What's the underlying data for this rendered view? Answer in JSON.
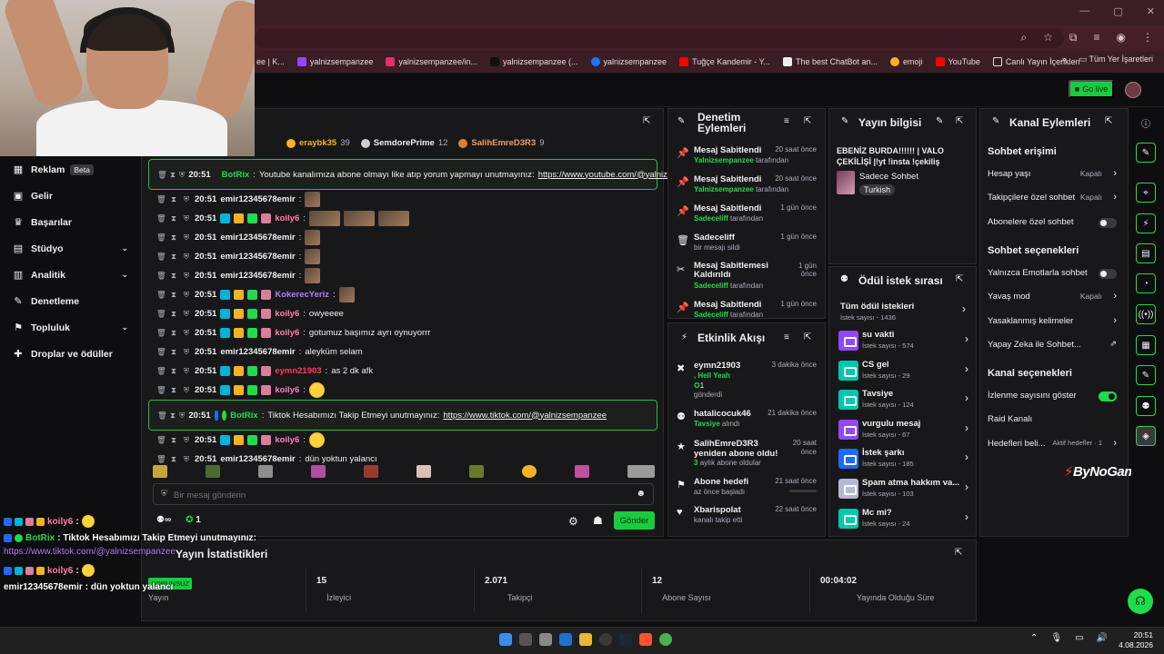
{
  "browser": {
    "bookmarks": [
      {
        "label": "ee | K...",
        "color": "#ad5cff"
      },
      {
        "label": "yalnizsempanzee",
        "color": "#9146ff"
      },
      {
        "label": "yalnizsempanzee/in...",
        "color": "#e1306c"
      },
      {
        "label": "yalnizsempanzee (...",
        "color": "#222222"
      },
      {
        "label": "yalnizsempanzee",
        "color": "#1877f2"
      },
      {
        "label": "Tuğçe Kandemir - Y...",
        "color": "#ff0000"
      },
      {
        "label": "The best ChatBot an...",
        "color": "#eeeeee"
      },
      {
        "label": "emoji",
        "color": "#f5b324"
      },
      {
        "label": "YouTube",
        "color": "#ff0000"
      },
      {
        "label": "Canlı Yayın İçerikleri",
        "color": "#e6dadd"
      }
    ],
    "all_bookmarks": "Tüm Yer İşaretleri"
  },
  "topbar": {
    "go_live": "Go live"
  },
  "sidebar": {
    "items": [
      {
        "label": "Reklam",
        "badge": "Beta",
        "icon": "ad-icon"
      },
      {
        "label": "Gelir",
        "icon": "revenue-icon"
      },
      {
        "label": "Başarılar",
        "icon": "trophy-icon"
      },
      {
        "label": "Stüdyo",
        "icon": "studio-icon",
        "expandable": true
      },
      {
        "label": "Analitik",
        "icon": "analytics-icon",
        "expandable": true
      },
      {
        "label": "Denetleme",
        "icon": "wrench-icon"
      },
      {
        "label": "Topluluk",
        "icon": "community-icon",
        "expandable": true
      },
      {
        "label": "Droplar ve ödüller",
        "icon": "gift-icon"
      }
    ]
  },
  "chat": {
    "leaderboard": [
      {
        "name": "eraybk35",
        "count": "39",
        "color": "#f5b324"
      },
      {
        "name": "SemdorePrime",
        "count": "12",
        "color": "#cfcfcf"
      },
      {
        "name": "SalihEmreD3R3",
        "count": "9",
        "color": "#d98236"
      }
    ],
    "messages": [
      {
        "time": "20:51",
        "user": "BotRix",
        "user_color": "#1fdc4b",
        "text": "Youtube kanalımıza abone olmayı like atıp yorum yapmayı unutmayınız:",
        "link": "https://www.youtube.com/@yalnizsempanzee",
        "highlight": true
      },
      {
        "time": "20:51",
        "user": "emir12345678emir",
        "user_color": "#efeff1",
        "text": "",
        "emotes": 1
      },
      {
        "time": "20:51",
        "user": "koily6",
        "user_color": "#ff7eb6",
        "text": "",
        "emotes": 3,
        "wide": true
      },
      {
        "time": "20:51",
        "user": "emir12345678emir",
        "user_color": "#efeff1",
        "text": "",
        "emotes": 1
      },
      {
        "time": "20:51",
        "user": "emir12345678emir",
        "user_color": "#efeff1",
        "text": "",
        "emotes": 1
      },
      {
        "time": "20:51",
        "user": "emir12345678emir",
        "user_color": "#efeff1",
        "text": "",
        "emotes": 1
      },
      {
        "time": "20:51",
        "user": "KokerecYeriz",
        "user_color": "#b57bff",
        "text": "",
        "emotes": 1
      },
      {
        "time": "20:51",
        "user": "koily6",
        "user_color": "#ff7eb6",
        "text": "owyeeee"
      },
      {
        "time": "20:51",
        "user": "koily6",
        "user_color": "#ff7eb6",
        "text": "gotumuz başımız ayrı oynuyorrr"
      },
      {
        "time": "20:51",
        "user": "emir12345678emir",
        "user_color": "#efeff1",
        "text": "aleyküm selam"
      },
      {
        "time": "20:51",
        "user": "eymn21903",
        "user_color": "#ff3d5a",
        "text": "as 2 dk afk"
      },
      {
        "time": "20:51",
        "user": "koily6",
        "user_color": "#ff7eb6",
        "text": "",
        "emotes": 1,
        "yellow": true
      },
      {
        "time": "20:51",
        "user": "BotRix",
        "user_color": "#1fdc4b",
        "text": "Tiktok Hesabımızı Takip Etmeyi unutmayınız:",
        "link": "https://www.tiktok.com/@yalnizsempanzee",
        "highlight": true
      },
      {
        "time": "20:51",
        "user": "koily6",
        "user_color": "#ff7eb6",
        "text": "",
        "emotes": 1,
        "yellow": true
      },
      {
        "time": "20:51",
        "user": "emir12345678emir",
        "user_color": "#efeff1",
        "text": "dün yoktun yalancı"
      }
    ],
    "input_placeholder": "Bir mesaj gönderin",
    "footer_count": "1",
    "send_label": "Gönder"
  },
  "mod_actions": {
    "title": "Denetim Eylemleri",
    "rows": [
      {
        "title": "Mesaj Sabitlendi",
        "user": "Yalnizsempanzee",
        "suffix": "tarafından",
        "time": "20 saat önce",
        "icon": "pin-icon"
      },
      {
        "title": "Mesaj Sabitlendi",
        "user": "Yalnizsempanzee",
        "suffix": "tarafından",
        "time": "20 saat önce",
        "icon": "pin-icon"
      },
      {
        "title": "Mesaj Sabitlendi",
        "user": "Sadeceliff",
        "suffix": "tarafından",
        "time": "1 gün önce",
        "icon": "pin-icon"
      },
      {
        "title": "Sadeceliff",
        "user": "",
        "suffix": "bir mesajı sildi",
        "time": "1 gün önce",
        "icon": "trash-icon"
      },
      {
        "title": "Mesaj Sabitlemesi Kaldırıldı",
        "user": "Sadeceliff",
        "suffix": "tarafından",
        "time": "1 gün önce",
        "icon": "unpin-icon"
      },
      {
        "title": "Mesaj Sabitlendi",
        "user": "Sadeceliff",
        "suffix": "tarafından",
        "time": "1 gün önce",
        "icon": "pin-icon"
      }
    ]
  },
  "activity": {
    "title": "Etkinlik Akışı",
    "rows": [
      {
        "title": "eymn21903",
        "sub_green": ", Hell Yeah",
        "sub2": "1",
        "sub3": "gönderdi",
        "time": "3 dakika önce",
        "icon": "bits-icon"
      },
      {
        "title": "hatalicocuk46",
        "sub_green": "Tavsiye",
        "sub": "alındı",
        "time": "21 dakika önce",
        "icon": "reward-icon"
      },
      {
        "title": "SalihEmreD3R3 yeniden abone oldu!",
        "sub_green": "3",
        "sub": "aylık abone oldular",
        "time": "20 saat önce",
        "icon": "star-icon"
      },
      {
        "title": "Abone hedefi",
        "sub": "az önce başladı",
        "time": "21 saat önce",
        "icon": "goal-icon"
      },
      {
        "title": "Xbarispolat",
        "sub": "kanalı takip etti",
        "time": "22 saat önce",
        "icon": "heart-icon"
      }
    ]
  },
  "stream_info": {
    "title": "Yayın bilgisi",
    "stream_title": "EBENİZ BURDA!!!!!! | VALO ÇEKİLİŞİ |!yt !insta !çekiliş",
    "category": "Sadece Sohbet",
    "tag": "Turkish"
  },
  "rewards": {
    "title": "Ödül istek sırası",
    "all_label": "Tüm ödül istekleri",
    "all_count": "İstek sayısı - 1436",
    "items": [
      {
        "name": "su vakti",
        "count": "İstek sayısı - 574",
        "color": "#9147ff"
      },
      {
        "name": "CS gel",
        "count": "İstek sayısı - 29",
        "color": "#00c8af"
      },
      {
        "name": "Tavsiye",
        "count": "İstek sayısı - 124",
        "color": "#00c8af"
      },
      {
        "name": "vurgulu mesaj",
        "count": "İstek sayısı - 67",
        "color": "#9147ff"
      },
      {
        "name": "İstek şarkı",
        "count": "İstek sayısı - 185",
        "color": "#1e69ff"
      },
      {
        "name": "Spam atma hakkım va...",
        "count": "İstek sayısı - 103",
        "color": "#b7b7d4"
      },
      {
        "name": "Mc mi?",
        "count": "İstek sayısı - 24",
        "color": "#00c8af"
      }
    ]
  },
  "channel_actions": {
    "title": "Kanal Eylemleri",
    "section1": "Sohbet erişimi",
    "row_age": {
      "label": "Hesap yaşı",
      "value": "Kapalı"
    },
    "row_followers": {
      "label": "Takipçilere özel sohbet",
      "value": "Kapalı"
    },
    "row_subs": {
      "label": "Abonelere özel sohbet"
    },
    "section2": "Sohbet seçenekleri",
    "row_emote": {
      "label": "Yalnızca Emotlarla sohbet"
    },
    "row_slow": {
      "label": "Yavaş mod",
      "value": "Kapalı"
    },
    "row_banned": {
      "label": "Yasaklanmış kelimeler"
    },
    "row_ai": {
      "label": "Yapay Zeka ile Sohbet..."
    },
    "section3": "Kanal seçenekleri",
    "row_viewers": {
      "label": "İzlenme sayısını göster"
    },
    "row_raid": {
      "label": "Raid Kanalı"
    },
    "row_goals": {
      "label": "Hedefleri beli...",
      "value": "Aktif hedefler · 1"
    }
  },
  "stats": {
    "title": "Yayın İstatistikleri",
    "status_badge": "SORUNSUZ",
    "items": [
      {
        "value": "",
        "label": "Yayın"
      },
      {
        "value": "15",
        "label": "İzleyici"
      },
      {
        "value": "2.071",
        "label": "Takipçi"
      },
      {
        "value": "12",
        "label": "Abone Sayısı"
      },
      {
        "value": "00:04:02",
        "label": "Yayında Olduğu Süre"
      }
    ]
  },
  "overlay_chat": [
    {
      "user": "koily6",
      "text": ":",
      "color": "#ff7eb6"
    },
    {
      "user": "BotRix",
      "text": ": Tiktok Hesabımızı Takip Etmeyi unutmayınız:",
      "color": "#1fdc4b"
    },
    {
      "link": "https://www.tiktok.com/@yalnizsempanzee"
    },
    {
      "user": "koily6",
      "text": ":",
      "color": "#ff7eb6"
    },
    {
      "user": "emir12345678emir",
      "text": ": dün yoktun yalancı",
      "color": "#ffffff"
    }
  ],
  "watermark": "ByNoGame",
  "taskbar": {
    "time": "20:51",
    "date": "4.08.2026"
  }
}
